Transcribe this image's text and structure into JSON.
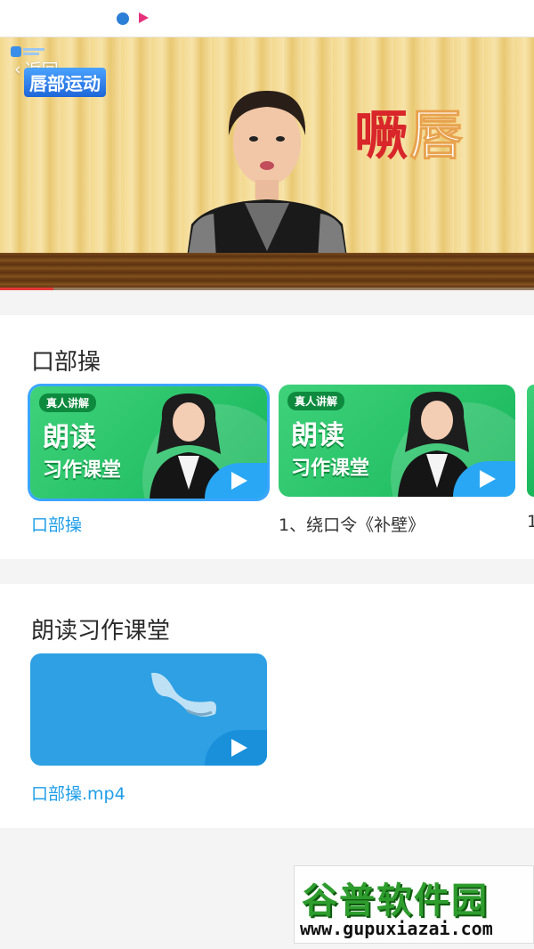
{
  "video": {
    "back_label": "返回",
    "topic": "唇部运动",
    "big_title_red": "噘",
    "big_title_white": "唇",
    "progress": 0.1
  },
  "section1": {
    "title": "口部操",
    "cards": [
      {
        "tag": "真人讲解",
        "line1": "朗读",
        "line2": "习作课堂",
        "caption": "口部操"
      },
      {
        "tag": "真人讲解",
        "line1": "朗读",
        "line2": "习作课堂",
        "caption": "1、绕口令《补壁》"
      }
    ],
    "partial_caption": "1"
  },
  "section2": {
    "title": "朗读习作课堂",
    "cards": [
      {
        "caption": "口部操.mp4"
      }
    ]
  },
  "watermark": {
    "name": "谷普软件园",
    "url": "www.gupuxiazai.com"
  },
  "colors": {
    "accent": "#1f9ee8",
    "card_green": "#17b65a",
    "card_blue": "#2ea0e3"
  }
}
